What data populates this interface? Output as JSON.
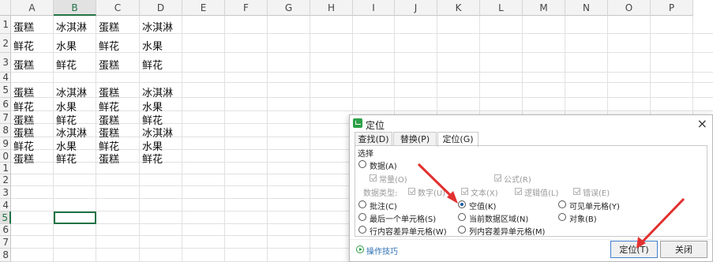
{
  "spreadsheet": {
    "columns": [
      "A",
      "B",
      "C",
      "D",
      "E",
      "F",
      "G",
      "H",
      "I",
      "J",
      "K",
      "L",
      "M",
      "N",
      "O",
      "P"
    ],
    "rows": [
      "1",
      "2",
      "3",
      "4",
      "5",
      "6",
      "7",
      "8",
      "9",
      "0",
      "1",
      "2",
      "3",
      "4",
      "5",
      "6",
      "7",
      "8"
    ],
    "selected_column": "B",
    "selected_row_index": 14,
    "cells": [
      [
        "蛋糕",
        "冰淇淋",
        "蛋糕",
        "冰淇淋"
      ],
      [
        "鲜花",
        "水果",
        "鲜花",
        "水果"
      ],
      [
        "蛋糕",
        "鲜花",
        "蛋糕",
        "鲜花"
      ],
      [
        "",
        "",
        "",
        ""
      ],
      [
        "蛋糕",
        "冰淇淋",
        "蛋糕",
        "冰淇淋"
      ],
      [
        "鲜花",
        "水果",
        "鲜花",
        "水果"
      ],
      [
        "蛋糕",
        "鲜花",
        "蛋糕",
        "鲜花"
      ],
      [
        "蛋糕",
        "冰淇淋",
        "蛋糕",
        "冰淇淋"
      ],
      [
        "鲜花",
        "水果",
        "鲜花",
        "水果"
      ],
      [
        "蛋糕",
        "鲜花",
        "蛋糕",
        "鲜花"
      ]
    ]
  },
  "dialog": {
    "title": "定位",
    "close": "×",
    "tabs": [
      "查找(D)",
      "替换(P)",
      "定位(G)"
    ],
    "active_tab": 2,
    "section_label": "选择",
    "options": {
      "data": "数据(A)",
      "constants": "常量(O)",
      "formulas": "公式(R)",
      "data_type_label": "数据类型:",
      "number": "数字(U)",
      "text": "文本(X)",
      "logical": "逻辑值(L)",
      "error": "错误(E)",
      "comments": "批注(C)",
      "blanks": "空值(K)",
      "visible_cells": "可见单元格(Y)",
      "last_cell": "最后一个单元格(S)",
      "current_region": "当前数据区域(N)",
      "objects": "对象(B)",
      "row_differences": "行内容差异单元格(W)",
      "col_differences": "列内容差异单元格(M)"
    },
    "selected_option": "blanks",
    "tips": "操作技巧",
    "locate_button": "定位(T)",
    "close_button": "关闭"
  },
  "colors": {
    "accent_green": "#217346",
    "arrow_red": "#e23030",
    "link_blue": "#2c6fb4"
  }
}
